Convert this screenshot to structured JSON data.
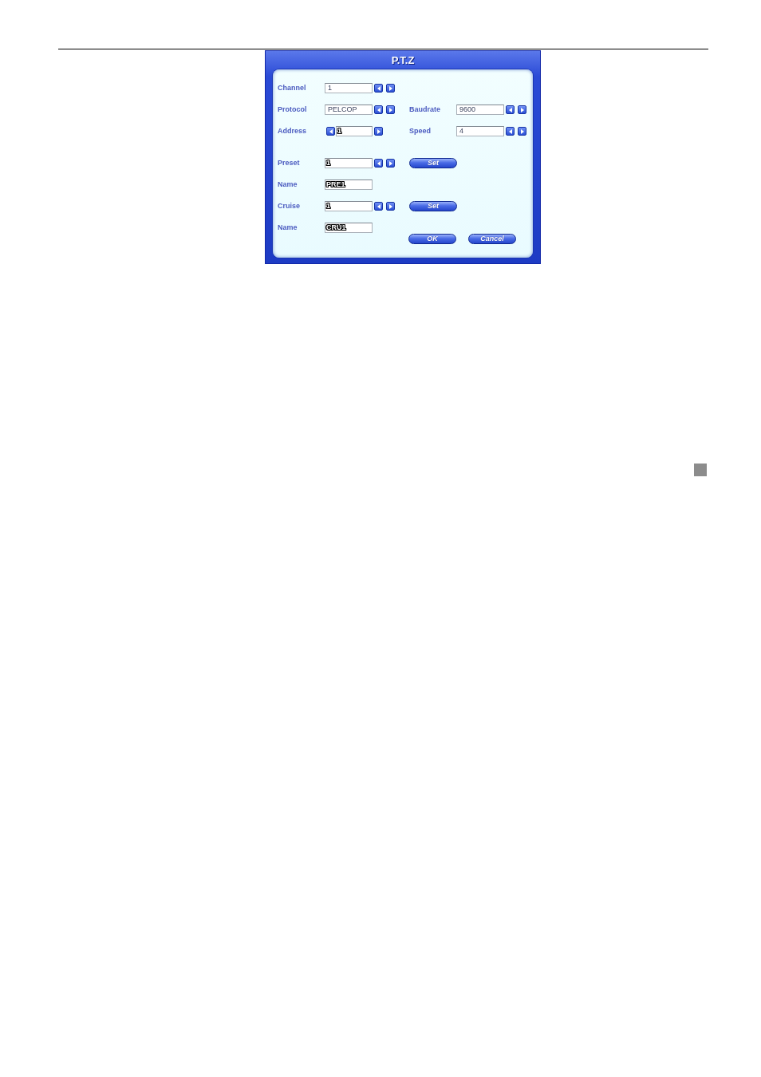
{
  "dialog": {
    "title": "P.T.Z",
    "sections": [
      {
        "rows": [
          {
            "label": "Channel",
            "field": {
              "value": "1",
              "kind": "spin",
              "outlined": false
            }
          },
          {
            "label": "Protocol",
            "field": {
              "value": "PELCOP",
              "kind": "spin",
              "outlined": false
            },
            "right": {
              "label": "Baudrate",
              "field": {
                "value": "9600",
                "kind": "spin",
                "outlined": false
              }
            }
          },
          {
            "label": "Address",
            "field": {
              "value": "1",
              "kind": "split",
              "outlined": true
            },
            "right": {
              "label": "Speed",
              "field": {
                "value": "4",
                "kind": "spin",
                "outlined": false
              }
            }
          }
        ]
      },
      {
        "rows": [
          {
            "label": "Preset",
            "field": {
              "value": "1",
              "kind": "spin",
              "outlined": true
            },
            "button": "Set"
          },
          {
            "label": "Name",
            "field": {
              "value": "PRE1",
              "kind": "text",
              "outlined": true
            }
          },
          {
            "label": "Cruise",
            "field": {
              "value": "1",
              "kind": "spin",
              "outlined": true
            },
            "button": "Set"
          },
          {
            "label": "Name",
            "field": {
              "value": "CRU1",
              "kind": "text",
              "outlined": true
            }
          }
        ]
      }
    ],
    "buttons": [
      "OK",
      "Cancel"
    ]
  }
}
